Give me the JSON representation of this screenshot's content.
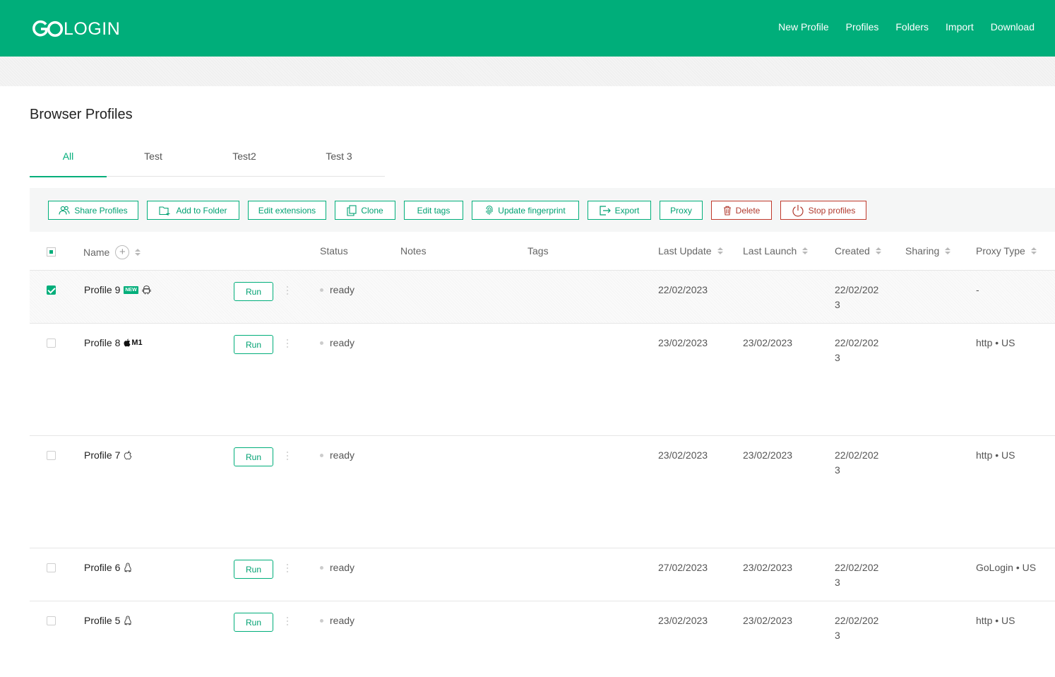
{
  "header": {
    "logo_go": "GO",
    "logo_login": "LOGIN",
    "nav": [
      "New Profile",
      "Profiles",
      "Folders",
      "Import",
      "Download"
    ]
  },
  "page_title": "Browser Profiles",
  "tabs": [
    "All",
    "Test",
    "Test2",
    "Test 3"
  ],
  "toolbar": {
    "share": "Share Profiles",
    "add_folder": "Add to Folder",
    "edit_extensions": "Edit extensions",
    "clone": "Clone",
    "edit_tags": "Edit tags",
    "update_fingerprint": "Update fingerprint",
    "export": "Export",
    "proxy": "Proxy",
    "delete": "Delete",
    "stop": "Stop profiles"
  },
  "columns": {
    "name": "Name",
    "status": "Status",
    "notes": "Notes",
    "tags": "Tags",
    "last_update": "Last Update",
    "last_launch": "Last Launch",
    "created": "Created",
    "sharing": "Sharing",
    "proxy_type": "Proxy Type"
  },
  "run_label": "Run",
  "new_badge": "NEW",
  "m1_label": "M1",
  "rows": [
    {
      "name": "Profile 9",
      "checked": true,
      "os_icon": "android-icon",
      "status": "ready",
      "last_update": "22/02/2023",
      "last_launch": "",
      "created": "22/02/2023",
      "proxy": "-"
    },
    {
      "name": "Profile 8",
      "checked": false,
      "os_icon": "apple-m1-icon",
      "status": "ready",
      "last_update": "23/02/2023",
      "last_launch": "23/02/2023",
      "created": "22/02/2023",
      "proxy": "http • US"
    },
    {
      "name": "Profile 7",
      "checked": false,
      "os_icon": "apple-icon",
      "status": "ready",
      "last_update": "23/02/2023",
      "last_launch": "23/02/2023",
      "created": "22/02/2023",
      "proxy": "http • US"
    },
    {
      "name": "Profile 6",
      "checked": false,
      "os_icon": "linux-icon",
      "status": "ready",
      "last_update": "27/02/2023",
      "last_launch": "23/02/2023",
      "created": "22/02/2023",
      "proxy": "GoLogin • US"
    },
    {
      "name": "Profile 5",
      "checked": false,
      "os_icon": "linux-icon",
      "status": "ready",
      "last_update": "23/02/2023",
      "last_launch": "23/02/2023",
      "created": "22/02/2023",
      "proxy": "http • US"
    }
  ]
}
